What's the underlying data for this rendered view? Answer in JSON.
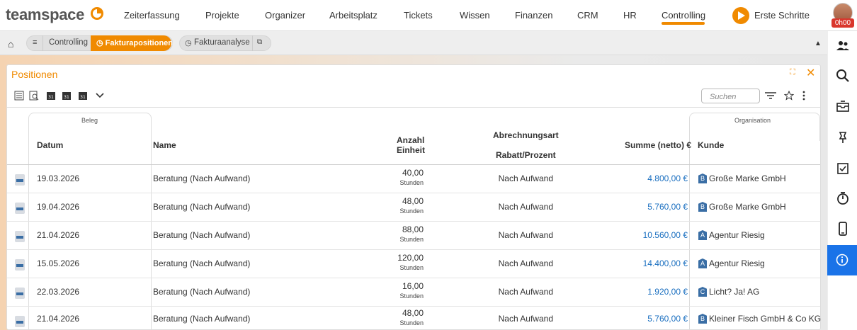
{
  "brand": {
    "name": "teamspace",
    "accent": "#f08a00",
    "link": "#1a6fc0",
    "info_active": "#1a73e8"
  },
  "nav": {
    "items": [
      "Zeiterfassung",
      "Projekte",
      "Organizer",
      "Arbeitsplatz",
      "Tickets",
      "Wissen",
      "Finanzen",
      "CRM",
      "HR",
      "Controlling"
    ],
    "active": "Controlling",
    "start_label": "Erste Schritte",
    "timer_badge": "0h00"
  },
  "breadcrumb": {
    "menu_icon": "hamburger-icon",
    "controlling": "Controlling",
    "active_tab": "Fakturapositionen",
    "second_tab": "Fakturaanalyse"
  },
  "panel": {
    "title": "Positionen",
    "search_placeholder": "Suchen"
  },
  "table": {
    "groups": {
      "beleg": "Beleg",
      "organisation": "Organisation"
    },
    "headers": {
      "datum": "Datum",
      "name": "Name",
      "anzahl": "Anzahl",
      "einheit": "Einheit",
      "abrechnungsart": "Abrechnungsart",
      "rabatt": "Rabatt/Prozent",
      "summe": "Summe (netto) €",
      "kunde": "Kunde"
    },
    "rows": [
      {
        "datum": "19.03.2026",
        "name": "Beratung (Nach Aufwand)",
        "anzahl": "40,00",
        "einheit": "Stunden",
        "abrechnungsart": "Nach Aufwand",
        "summe": "4.800,00 €",
        "badge": "B",
        "kunde": "Große Marke GmbH"
      },
      {
        "datum": "19.04.2026",
        "name": "Beratung (Nach Aufwand)",
        "anzahl": "48,00",
        "einheit": "Stunden",
        "abrechnungsart": "Nach Aufwand",
        "summe": "5.760,00 €",
        "badge": "B",
        "kunde": "Große Marke GmbH"
      },
      {
        "datum": "21.04.2026",
        "name": "Beratung (Nach Aufwand)",
        "anzahl": "88,00",
        "einheit": "Stunden",
        "abrechnungsart": "Nach Aufwand",
        "summe": "10.560,00 €",
        "badge": "A",
        "kunde": "Agentur Riesig"
      },
      {
        "datum": "15.05.2026",
        "name": "Beratung (Nach Aufwand)",
        "anzahl": "120,00",
        "einheit": "Stunden",
        "abrechnungsart": "Nach Aufwand",
        "summe": "14.400,00 €",
        "badge": "A",
        "kunde": "Agentur Riesig"
      },
      {
        "datum": "22.03.2026",
        "name": "Beratung (Nach Aufwand)",
        "anzahl": "16,00",
        "einheit": "Stunden",
        "abrechnungsart": "Nach Aufwand",
        "summe": "1.920,00 €",
        "badge": "C",
        "kunde": "Licht? Ja! AG"
      },
      {
        "datum": "21.04.2026",
        "name": "Beratung (Nach Aufwand)",
        "anzahl": "48,00",
        "einheit": "Stunden",
        "abrechnungsart": "Nach Aufwand",
        "summe": "5.760,00 €",
        "badge": "B",
        "kunde": "Kleiner Fisch GmbH & Co KG"
      }
    ]
  },
  "sidebar_icons": [
    "people-icon",
    "search-icon",
    "inbox-icon",
    "pin-icon",
    "tasks-icon",
    "stopwatch-icon",
    "mobile-icon",
    "info-icon"
  ]
}
